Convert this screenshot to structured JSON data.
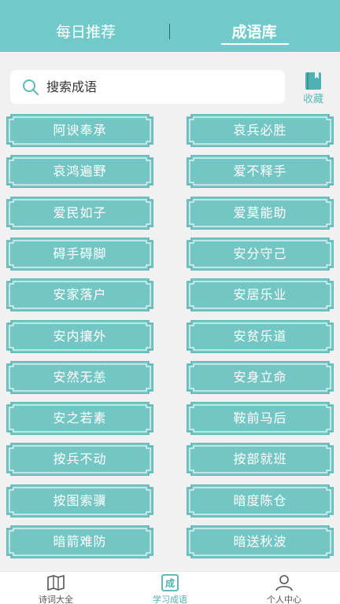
{
  "header": {
    "tab_daily": "每日推荐",
    "tab_library": "成语库"
  },
  "search": {
    "placeholder": "搜索成语"
  },
  "favorite": {
    "label": "收藏"
  },
  "idioms": [
    "阿谀奉承",
    "哀兵必胜",
    "哀鸿遍野",
    "爱不释手",
    "爱民如子",
    "爱莫能助",
    "碍手碍脚",
    "安分守己",
    "安家落户",
    "安居乐业",
    "安内攘外",
    "安贫乐道",
    "安然无恙",
    "安身立命",
    "安之若素",
    "鞍前马后",
    "按兵不动",
    "按部就班",
    "按图索骥",
    "暗度陈仓",
    "暗箭难防",
    "暗送秋波"
  ],
  "bottom_nav": {
    "items": [
      {
        "label": "诗词大全",
        "icon": "book-open-icon"
      },
      {
        "label": "学习成语",
        "icon": "idiom-icon",
        "glyph": "成"
      },
      {
        "label": "个人中心",
        "icon": "person-icon"
      }
    ]
  },
  "colors": {
    "accent": "#71c9c9",
    "card_fill": "#74c6c4",
    "card_border": "#5cb3b1"
  }
}
